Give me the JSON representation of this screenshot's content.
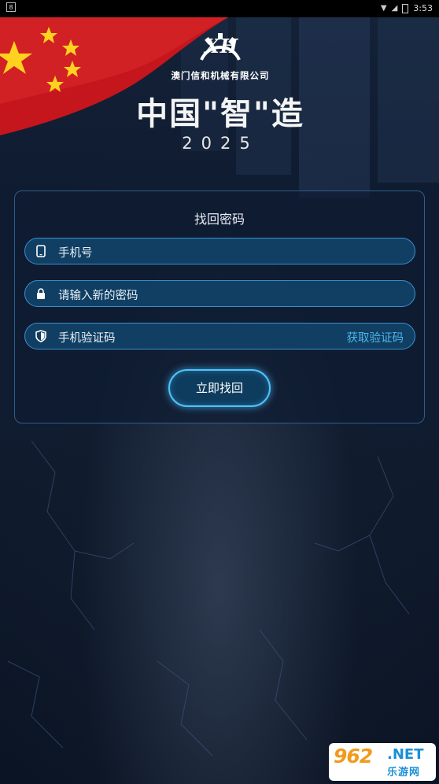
{
  "status_bar": {
    "time": "3:53",
    "left_icon": "notification-icon"
  },
  "header": {
    "logo_mark": "XH",
    "company_name": "澳门信和机械有限公司",
    "slogan": "中国\"智\"造",
    "year": "2025"
  },
  "form": {
    "title": "找回密码",
    "phone_placeholder": "手机号",
    "new_password_placeholder": "请输入新的密码",
    "code_placeholder": "手机验证码",
    "get_code_label": "获取验证码",
    "submit_label": "立即找回"
  },
  "watermark": {
    "number": "962",
    "net": ".NET",
    "site": "乐游网"
  },
  "colors": {
    "accent": "#4fc3ff",
    "field_bg": "#103f63",
    "link": "#4fb4e8"
  }
}
